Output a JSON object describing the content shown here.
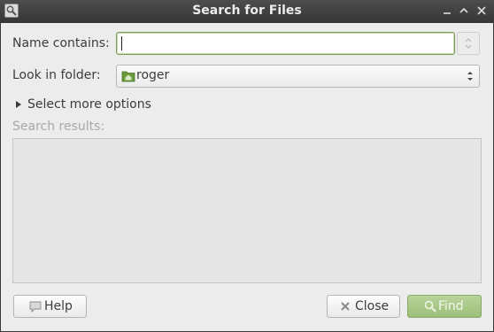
{
  "window": {
    "title": "Search for Files"
  },
  "form": {
    "name_label": "Name contains:",
    "name_value": "",
    "folder_label": "Look in folder:",
    "folder_value": "roger",
    "more_options_label": "Select more options",
    "results_label": "Search results:"
  },
  "buttons": {
    "help": "Help",
    "close": "Close",
    "find": "Find"
  },
  "icons": {
    "app": "search-icon",
    "folder": "home-folder-icon",
    "help": "help-icon",
    "close": "close-icon",
    "find": "magnifier-icon"
  },
  "colors": {
    "accent": "#9cbf78",
    "titlebar": "#3c3c3c",
    "background": "#ececec"
  }
}
